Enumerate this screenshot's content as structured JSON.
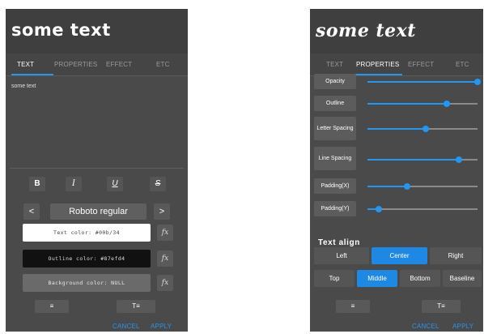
{
  "left_panel": {
    "preview_text": "some text",
    "tabs": [
      {
        "label": "TEXT",
        "active": true
      },
      {
        "label": "PROPERTIES",
        "active": false
      },
      {
        "label": "EFFECT",
        "active": false
      },
      {
        "label": "ETC",
        "active": false
      }
    ],
    "text_content": "some text",
    "format_buttons": {
      "bold": "B",
      "italic": "I",
      "underline": "U",
      "strike": "S"
    },
    "font": {
      "prev": "<",
      "name": "Roboto regular",
      "next": ">"
    },
    "text_color_label": "Text color: #00b/34",
    "outline_color_label": "Outline color: #87efd4",
    "background_color_label": "Background color: NULL",
    "fx_label": "fx",
    "tool_list_label": "≡",
    "tool_text_label": "T≡",
    "cancel": "CANCEL",
    "apply": "APPLY"
  },
  "right_panel": {
    "preview_text": "some text",
    "tabs": [
      {
        "label": "TEXT",
        "active": false
      },
      {
        "label": "PROPERTIES",
        "active": true
      },
      {
        "label": "EFFECT",
        "active": false
      },
      {
        "label": "ETC",
        "active": false
      }
    ],
    "sliders": {
      "opacity": {
        "label": "Opacity",
        "value": 1.0
      },
      "outline": {
        "label": "Outline",
        "value": 0.72
      },
      "letter_spacing": {
        "label": "Letter Spacing",
        "value": 0.53
      },
      "line_spacing": {
        "label": "Line Spacing",
        "value": 0.83
      },
      "padding_x": {
        "label": "Padding(X)",
        "value": 0.36
      },
      "padding_y": {
        "label": "Padding(Y)",
        "value": 0.1
      }
    },
    "text_align_title": "Text align",
    "horizontal_align": {
      "left": "Left",
      "center": "Center",
      "right": "Right",
      "selected": "Center"
    },
    "vertical_align": {
      "top": "Top",
      "middle": "Middle",
      "bottom": "Bottom",
      "baseline": "Baseline",
      "selected": "Middle"
    },
    "tool_list_label": "≡",
    "tool_text_label": "T≡",
    "cancel": "CANCEL",
    "apply": "APPLY"
  },
  "colors": {
    "accent": "#2196f3",
    "panel_bg": "#4a4a4a",
    "text_color_swatch": "#ffffff",
    "outline_color_swatch": "#111111",
    "background_color_swatch": "#6a6a6a"
  }
}
